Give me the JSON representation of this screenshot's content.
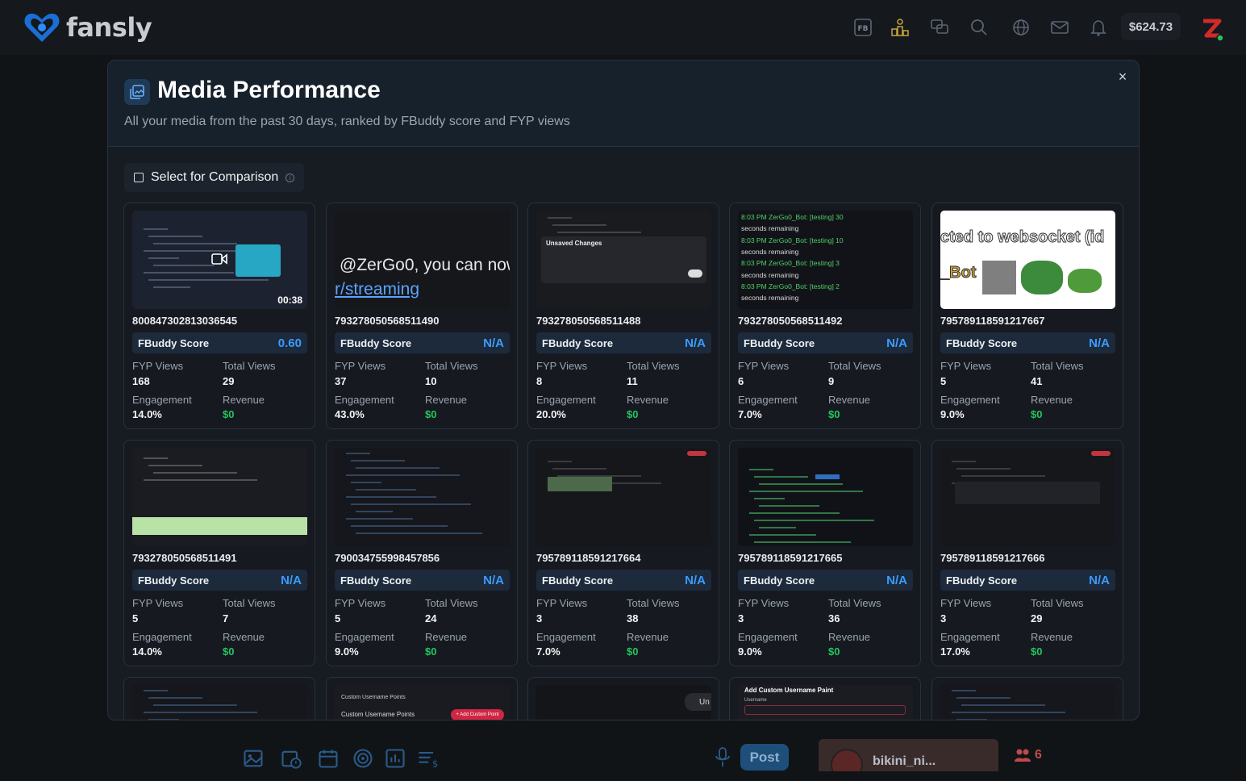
{
  "brand": {
    "name": "fansly"
  },
  "topbar": {
    "icons": [
      {
        "name": "fb-badge-icon",
        "label": "FB"
      },
      {
        "name": "leaderboard-icon"
      },
      {
        "name": "chat-icon"
      },
      {
        "name": "search-icon"
      },
      {
        "name": "globe-icon"
      },
      {
        "name": "mail-icon"
      },
      {
        "name": "bell-icon"
      }
    ],
    "balance": "$624.73"
  },
  "modal": {
    "title": "Media Performance",
    "subtitle": "All your media from the past 30 days, ranked by FBuddy score and FYP views",
    "close": "×",
    "compare_label": "Select for Comparison",
    "info": "i"
  },
  "labels": {
    "score": "FBuddy Score",
    "fyp": "FYP Views",
    "total": "Total Views",
    "engagement": "Engagement",
    "revenue": "Revenue"
  },
  "cards": [
    {
      "id": "800847302813036545",
      "score": "0.60",
      "fyp": "168",
      "total": "29",
      "engagement": "14.0%",
      "revenue": "$0",
      "duration": "00:38",
      "thumb": "overlay"
    },
    {
      "id": "793278050568511490",
      "score": "N/A",
      "fyp": "37",
      "total": "10",
      "engagement": "43.0%",
      "revenue": "$0",
      "thumb": "chattext",
      "thumb_line1": "@ZerGo0, you can now",
      "thumb_line2": "r/streaming"
    },
    {
      "id": "793278050568511488",
      "score": "N/A",
      "fyp": "8",
      "total": "11",
      "engagement": "20.0%",
      "revenue": "$0",
      "thumb": "dialog",
      "thumb_title": "Unsaved Changes"
    },
    {
      "id": "793278050568511492",
      "score": "N/A",
      "fyp": "6",
      "total": "9",
      "engagement": "7.0%",
      "revenue": "$0",
      "thumb": "chatlog",
      "thumb_lines": [
        "8:03 PM ZerGo0_Bot: [testing] 30",
        "seconds remaining",
        "8:03 PM ZerGo0_Bot: [testing] 10",
        "seconds remaining",
        "8:03 PM ZerGo0_Bot: [testing] 3",
        "seconds remaining",
        "8:03 PM ZerGo0_Bot: [testing] 2",
        "seconds remaining"
      ]
    },
    {
      "id": "795789118591217667",
      "score": "N/A",
      "fyp": "5",
      "total": "41",
      "engagement": "9.0%",
      "revenue": "$0",
      "thumb": "websocket",
      "thumb_line1": "cted to websocket (id",
      "thumb_line2": "_Bot"
    },
    {
      "id": "793278050568511491",
      "score": "N/A",
      "fyp": "5",
      "total": "7",
      "engagement": "14.0%",
      "revenue": "$0",
      "thumb": "table"
    },
    {
      "id": "790034755998457856",
      "score": "N/A",
      "fyp": "5",
      "total": "24",
      "engagement": "9.0%",
      "revenue": "$0",
      "thumb": "dark"
    },
    {
      "id": "795789118591217664",
      "score": "N/A",
      "fyp": "3",
      "total": "38",
      "engagement": "7.0%",
      "revenue": "$0",
      "thumb": "emotes"
    },
    {
      "id": "795789118591217665",
      "score": "N/A",
      "fyp": "3",
      "total": "36",
      "engagement": "9.0%",
      "revenue": "$0",
      "thumb": "history"
    },
    {
      "id": "795789118591217666",
      "score": "N/A",
      "fyp": "3",
      "total": "29",
      "engagement": "17.0%",
      "revenue": "$0",
      "thumb": "emotes2"
    }
  ],
  "partial_cards": [
    {
      "thumb": "dark"
    },
    {
      "thumb": "custom",
      "thumb_title": "Custom Username Points",
      "thumb_button": "+ Add Custom Point"
    },
    {
      "thumb": "blank",
      "thumb_chip": "Un"
    },
    {
      "thumb": "paint",
      "thumb_title": "Add Custom Username Paint",
      "thumb_label": "Username"
    },
    {
      "thumb": "dark"
    }
  ],
  "under": {
    "post": "Post",
    "creator": "bikini_ni...",
    "members": "6"
  }
}
